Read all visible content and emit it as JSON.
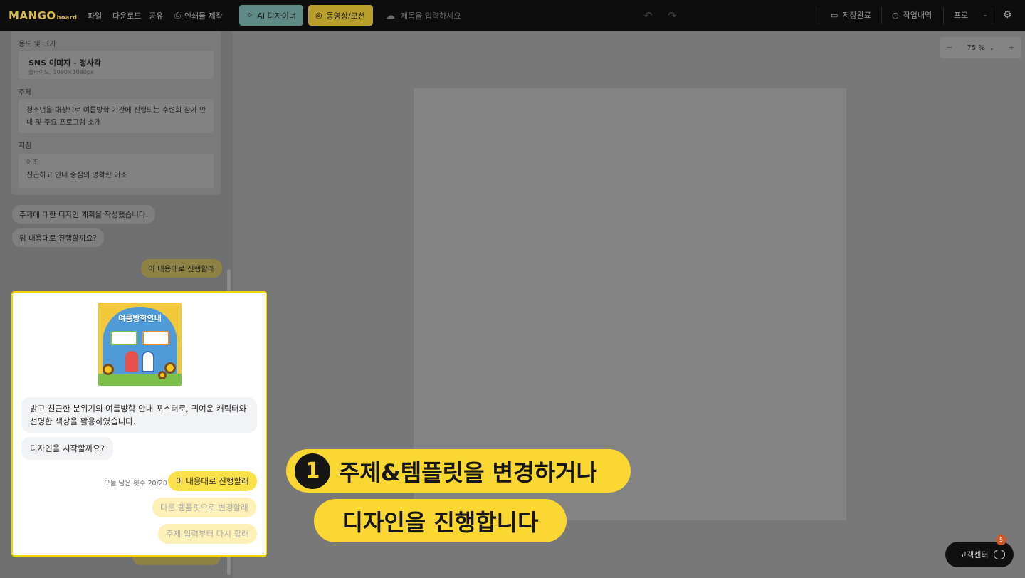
{
  "topbar": {
    "logo": "MANGO",
    "logo_sub": "board",
    "menu": [
      "파일",
      "다운로드",
      "공유",
      "인쇄물 제작"
    ],
    "ai_designer": "AI 디자이너",
    "video_motion": "동영상/모션",
    "title_placeholder": "제목을 입력하세요",
    "save_status": "저장완료",
    "history": "작업내역",
    "plan": "프로"
  },
  "left_panel": {
    "usage_label": "용도 및 크기",
    "usage_title": "SNS 이미지 - 정사각",
    "usage_sub": "슬라이드, 1080×1080px",
    "topic_label": "주제",
    "topic_text": "청소년을 대상으로 여름방학 기간에 진행되는 수련회 참가 안내 및 주요 프로그램 소개",
    "guide_label": "지침",
    "tone_label": "어조",
    "tone_text": "친근하고 안내 중심의 명확한 어조",
    "msg1": "주제에 대한 디자인 계획을 작성했습니다.",
    "msg2": "위 내용대로 진행할까요?",
    "reply": "이 내용대로 진행할래"
  },
  "zoom": {
    "minus": "−",
    "level": "75 %",
    "plus": "+"
  },
  "highlight_card": {
    "poster_title": "여름방학안내",
    "desc": "밝고 친근한 분위기의 여름방학 안내 포스터로, 귀여운 캐릭터와 선명한 색상을 활용하였습니다.",
    "question": "디자인을 시작할까요?",
    "remaining": "오늘 남은 횟수 20/20",
    "option1": "이 내용대로 진행할래",
    "option2": "다른 템플릿으로 변경할래",
    "option3": "주제 입력부터 다시 할래"
  },
  "callouts": {
    "number": "1",
    "line1": "주제&템플릿을 변경하거나",
    "line2": "디자인을 진행합니다"
  },
  "help": {
    "label": "고객센터",
    "badge": "5"
  }
}
